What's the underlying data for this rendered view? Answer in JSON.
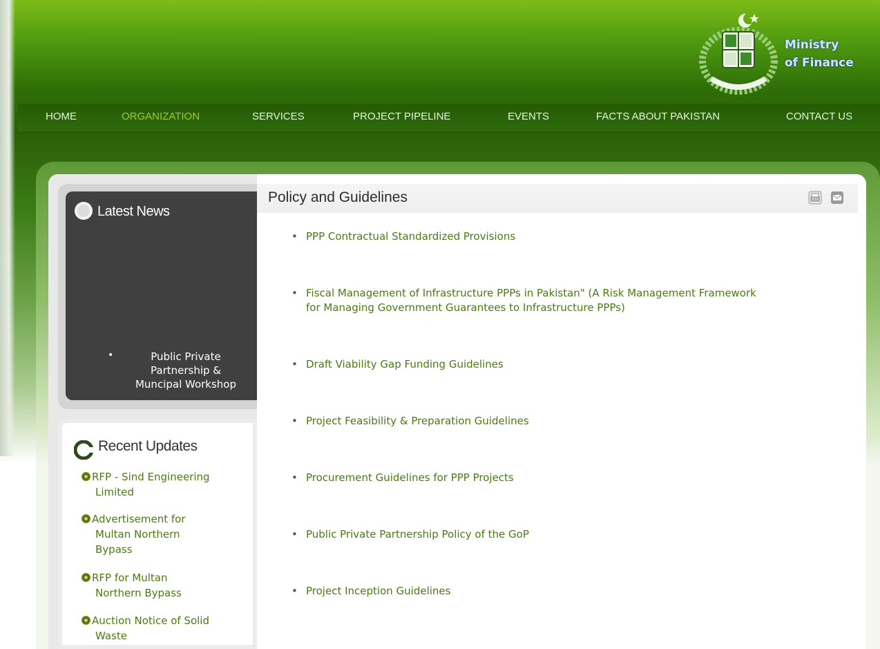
{
  "brand": {
    "line1": "Ministry",
    "line2": "of Finance",
    "color": "#cfe6ff"
  },
  "nav": {
    "items": [
      {
        "label": "HOME"
      },
      {
        "label": "ORGANIZATION",
        "active": true
      },
      {
        "label": "SERVICES"
      },
      {
        "label": "PROJECT PIPELINE"
      },
      {
        "label": "EVENTS"
      },
      {
        "label": "FACTS ABOUT PAKISTAN"
      },
      {
        "label": "CONTACT US"
      }
    ],
    "active_color": "#a4c92c"
  },
  "sidebar": {
    "latest_news": {
      "title": "Latest News",
      "items": [
        {
          "line1": "Public Private",
          "line2": "Partnership &",
          "line3": "Muncipal Workshop"
        }
      ]
    },
    "recent_updates": {
      "title": "Recent Updates",
      "items": [
        {
          "lines": [
            "RFP - Sind Engineering",
            "Limited"
          ]
        },
        {
          "lines": [
            "Advertisement for",
            "Multan Northern",
            "Bypass"
          ]
        },
        {
          "lines": [
            "RFP for Multan",
            "Northern Bypass"
          ]
        },
        {
          "lines": [
            "Auction Notice of Solid",
            "Waste"
          ]
        }
      ]
    }
  },
  "main": {
    "title": "Policy and Guidelines",
    "tools": [
      {
        "icon": "print-icon"
      },
      {
        "icon": "email-icon"
      }
    ],
    "items": [
      {
        "line1": "PPP Contractual Standardized Provisions"
      },
      {
        "line1": " Fiscal Management of Infrastructure PPPs in Pakistan\" (A Risk Management Framework",
        "line2": "for Managing Government Guarantees to Infrastructure PPPs)"
      },
      {
        "line1": "Draft Viability Gap Funding Guidelines"
      },
      {
        "line1": "Project Feasibility & Preparation Guidelines"
      },
      {
        "line1": "Procurement Guidelines for PPP Projects"
      },
      {
        "line1": "Public Private Partnership Policy of the GoP"
      },
      {
        "line1": "Project Inception Guidelines"
      }
    ]
  },
  "colors": {
    "link_green": "#4a7a12",
    "header_green": "#2e6a0c",
    "news_bg": "#404040"
  }
}
